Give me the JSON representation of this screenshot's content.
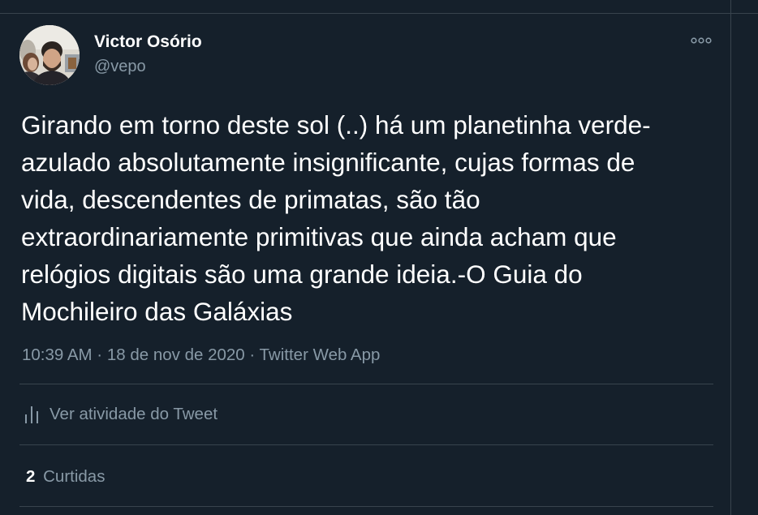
{
  "author": {
    "name": "Victor Osório",
    "handle": "@vepo"
  },
  "tweet": {
    "text": "Girando em torno deste sol (..) há um planetinha verde-\nazulado absolutamente insignificante, cujas formas de\nvida, descendentes de primatas, são tão\nextraordinariamente primitivas que ainda acham que\nrelógios digitais são uma grande ideia.-O Guia do\nMochileiro das Galáxias",
    "meta": "10:39 AM · 18 de nov de 2020 · Twitter Web App"
  },
  "actions": {
    "activity_label": "Ver atividade do Tweet",
    "activity_icon": "bar-chart-icon",
    "more_icon": "more-dots-icon"
  },
  "stats": {
    "likes_count": "2",
    "likes_label": "Curtidas"
  },
  "colors": {
    "background": "#15202b",
    "border": "#38444d",
    "text_primary": "#ffffff",
    "text_secondary": "#8899a6"
  }
}
